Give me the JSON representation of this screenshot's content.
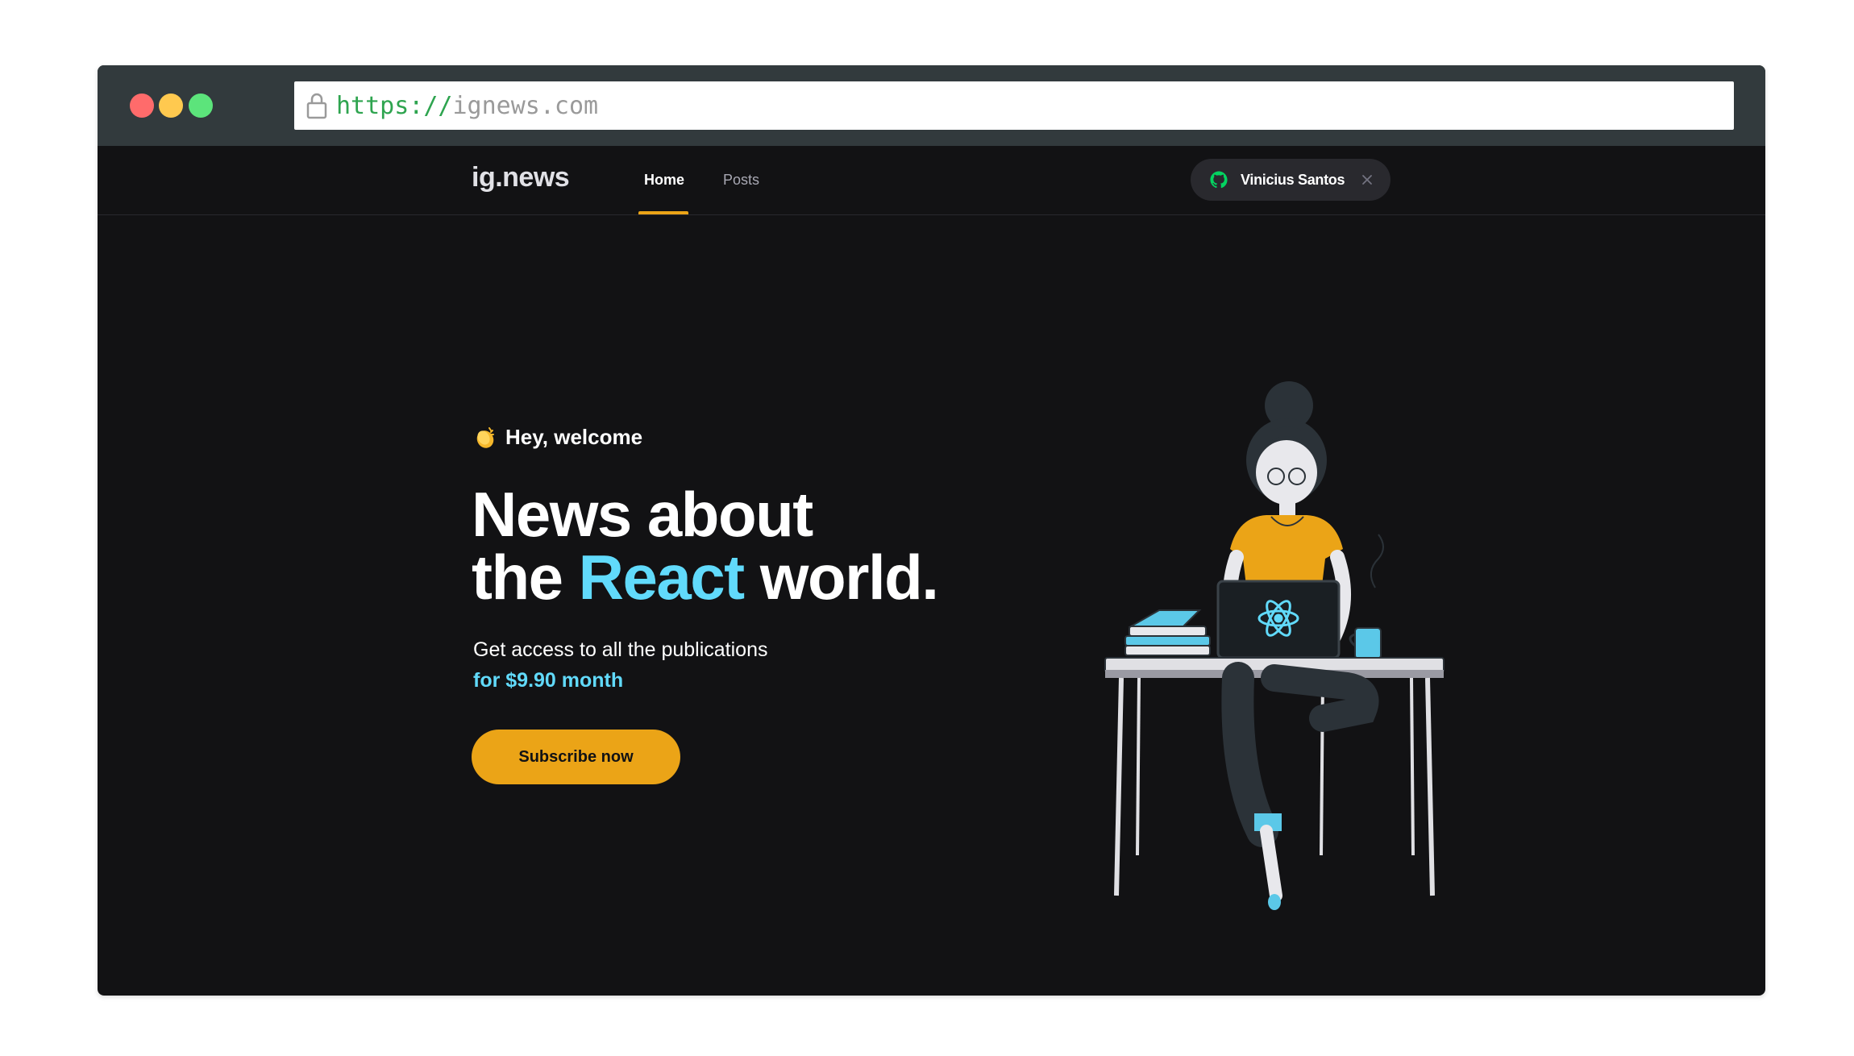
{
  "browser": {
    "url_scheme": "https://",
    "url_host": "ignews.com"
  },
  "header": {
    "logo": "ig.news",
    "nav": [
      {
        "label": "Home",
        "active": true
      },
      {
        "label": "Posts",
        "active": false
      }
    ],
    "user": {
      "name": "Vinicius Santos",
      "icon": "github-icon"
    }
  },
  "hero": {
    "welcome": "Hey, welcome",
    "title_line1": "News about",
    "title_pre": "the ",
    "title_accent": "React",
    "title_post": " world.",
    "description": "Get access to all the publications",
    "price": "for $9.90 month",
    "cta": "Subscribe now"
  },
  "colors": {
    "background": "#121214",
    "accent_yellow": "#eba417",
    "accent_cyan": "#61dafb",
    "header_border": "#29292e"
  }
}
